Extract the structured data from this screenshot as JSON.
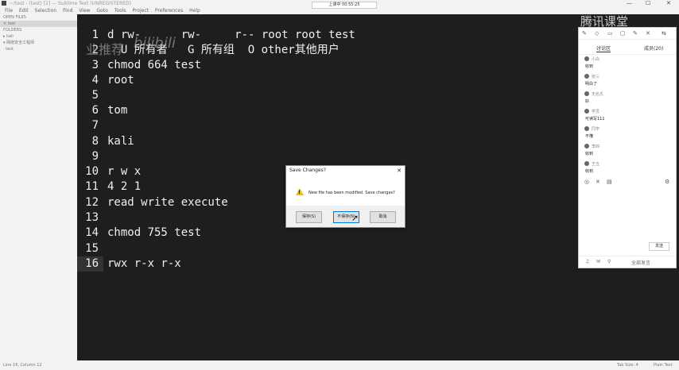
{
  "window": {
    "title": "~/test - (test) [2] — Sublime Text (UNREGISTERED)",
    "minimize": "—",
    "maximize": "☐",
    "close": "✕"
  },
  "menu": [
    "File",
    "Edit",
    "Selection",
    "Find",
    "View",
    "Goto",
    "Tools",
    "Project",
    "Preferences",
    "Help"
  ],
  "sidebar": {
    "items": [
      "OPEN FILES",
      "× test",
      "FOLDERS",
      "▸ kali",
      "▾ 网络安全工程师",
      "· test"
    ]
  },
  "editor": {
    "lines": [
      {
        "num": "1",
        "text": "d rw-      rw-     r-- root root test"
      },
      {
        "num": "2",
        "text": "  U 所有者   G 所有组  O other其他用户"
      },
      {
        "num": "3",
        "text": "chmod 664 test"
      },
      {
        "num": "4",
        "text": "root"
      },
      {
        "num": "5",
        "text": ""
      },
      {
        "num": "6",
        "text": "tom"
      },
      {
        "num": "7",
        "text": ""
      },
      {
        "num": "8",
        "text": "kali"
      },
      {
        "num": "9",
        "text": ""
      },
      {
        "num": "10",
        "text": "r w x"
      },
      {
        "num": "11",
        "text": "4 2 1"
      },
      {
        "num": "12",
        "text": "read write execute"
      },
      {
        "num": "13",
        "text": ""
      },
      {
        "num": "14",
        "text": "chmod 755 test"
      },
      {
        "num": "15",
        "text": ""
      },
      {
        "num": "16",
        "text": "rwx r-x r-x"
      }
    ]
  },
  "overlay": {
    "watermark": "业推荐",
    "bilibili": "bilibili",
    "recording": "上课中 00:55:25",
    "tencent": "腾讯课堂"
  },
  "dialog": {
    "title": "Save Changes?",
    "close": "✕",
    "message": "New file has been modified. Save changes?",
    "buttons": [
      "保存(S)",
      "不保存(N)",
      "取消"
    ]
  },
  "panel": {
    "toolbar": [
      "✎",
      "◇",
      "▭",
      "▢",
      "✎",
      "✕",
      "⇆"
    ],
    "tabs": [
      "讨论区",
      "成员(20)"
    ],
    "entries": [
      {
        "name": "小白",
        "msg": "收到"
      },
      {
        "name": "张三",
        "msg": "明白了"
      },
      {
        "name": "无名氏",
        "msg": "好"
      },
      {
        "name": "学员",
        "msg": "可读写111"
      },
      {
        "name": "同学",
        "msg": "不懂"
      },
      {
        "name": "李四",
        "msg": "收到"
      },
      {
        "name": "王五",
        "msg": "收到"
      }
    ],
    "icons": [
      "◎",
      "✕",
      "▤",
      "⚙"
    ],
    "send_label": "发送",
    "footer": [
      "♫",
      "✉",
      "⚲",
      "全部发言"
    ]
  },
  "status": {
    "left": "Line 16, Column 12",
    "tab": "Tab Size: 4",
    "syntax": "Plain Text"
  }
}
